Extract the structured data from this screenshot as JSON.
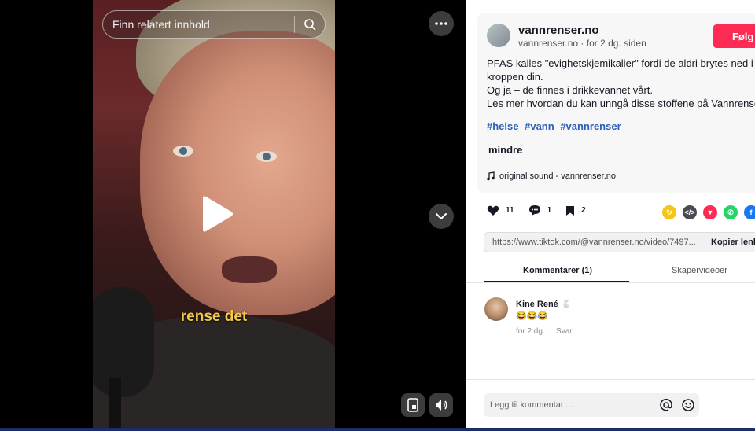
{
  "video": {
    "search_placeholder": "Finn relatert innhold",
    "caption": "rense det"
  },
  "post": {
    "author": "vannrenser.no",
    "handle": "vannrenser.no",
    "time": "for 2 dg. siden",
    "meta_separator": " · ",
    "follow_label": "Følg",
    "description": [
      "PFAS kalles \"evighetskjemikalier\" fordi de aldri brytes ned i",
      "kroppen din.",
      "Og ja – de finnes i drikkevannet vårt.",
      "Les mer hvordan du kan unngå disse stoffene på Vannrenser.no"
    ],
    "hashtags": [
      "#helse",
      "#vann",
      "#vannrenser"
    ],
    "less_label": "mindre",
    "sound": "original sound - vannrenser.no"
  },
  "actions": {
    "likes": "11",
    "comments": "1",
    "saves": "2"
  },
  "share_colors": {
    "repost": "#f5c518",
    "embed": "#4b4b55",
    "send": "#fe2c55",
    "whatsapp": "#25d366",
    "facebook": "#1877f2"
  },
  "link": {
    "url": "https://www.tiktok.com/@vannrenser.no/video/7497...",
    "copy_label": "Kopier lenke"
  },
  "tabs": {
    "comments": "Kommentarer (1)",
    "creator_videos": "Skapervideoer"
  },
  "comments": [
    {
      "name": "Kine René 🐇",
      "text": "😂😂😂",
      "time": "for 2 dg...",
      "reply": "Svar"
    }
  ],
  "comment_input": {
    "placeholder": "Legg til kommentar ..."
  }
}
